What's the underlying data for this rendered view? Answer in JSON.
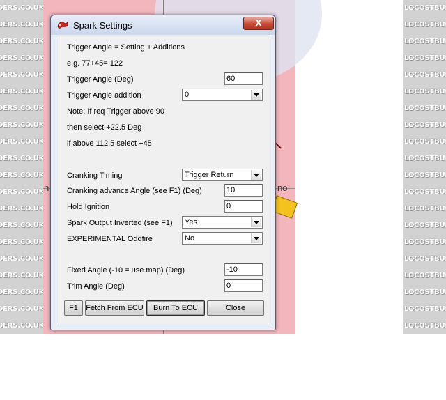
{
  "window": {
    "title": "Spark Settings",
    "close_label": "X",
    "icon": "spark-app-icon"
  },
  "background": {
    "watermark_left": "DERS.CO.UK",
    "watermark_right": "LOCOSTBUILDERS.CO.UK",
    "text_no": "no",
    "text_n": "n"
  },
  "form": {
    "formula": "Trigger Angle = Setting + Additions",
    "example": "e.g. 77+45= 122",
    "trigger_angle": {
      "label": "Trigger Angle  (Deg)",
      "value": "60"
    },
    "trigger_addition": {
      "label": "Trigger Angle addition",
      "value": "0"
    },
    "note1": "Note: If req Trigger above 90",
    "note2": "then select +22.5 Deg",
    "note3": "if above 112.5 select +45",
    "cranking_timing": {
      "label": "Cranking Timing",
      "value": "Trigger Return"
    },
    "cranking_advance": {
      "label": "Cranking advance Angle (see F1) (Deg)",
      "value": "10"
    },
    "hold_ignition": {
      "label": "Hold Ignition",
      "value": "0"
    },
    "spark_inverted": {
      "label": "Spark Output Inverted (see F1)",
      "value": "Yes"
    },
    "oddfire": {
      "label": "EXPERIMENTAL Oddfire",
      "value": "No"
    },
    "fixed_angle": {
      "label": "Fixed Angle (-10 = use map) (Deg)",
      "value": "-10"
    },
    "trim_angle": {
      "label": "Trim Angle (Deg)",
      "value": "0"
    }
  },
  "buttons": {
    "f1": "F1",
    "fetch": "Fetch From ECU",
    "burn": "Burn To ECU",
    "close": "Close"
  },
  "colors": {
    "background_pink": "#f2b6bc",
    "close_red": "#c64a35",
    "watermark_grey": "#d2d2d2"
  }
}
